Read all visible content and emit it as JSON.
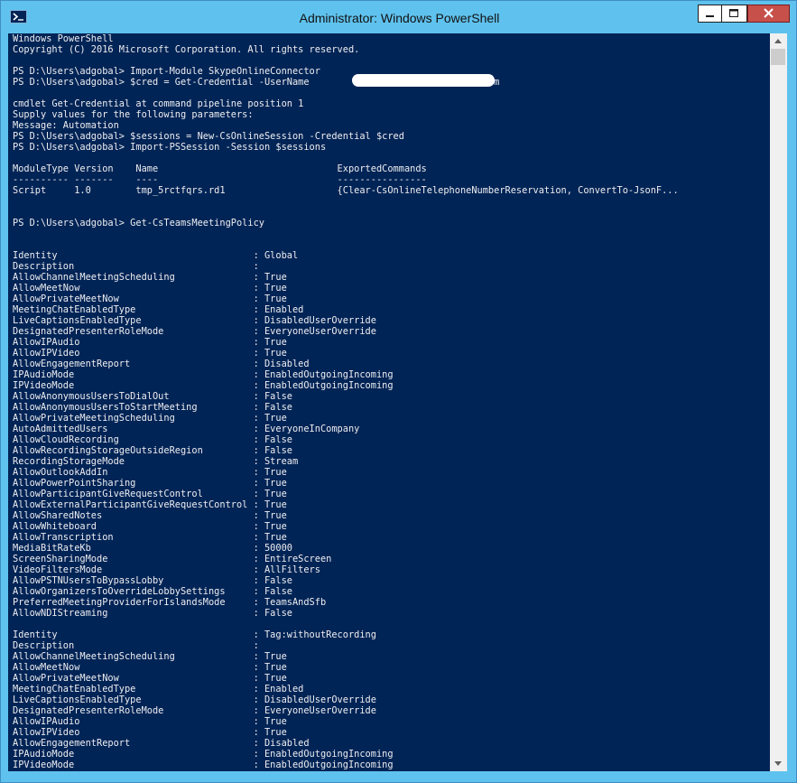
{
  "window": {
    "title": "Administrator: Windows PowerShell",
    "icon": "powershell-icon",
    "controls": [
      "minimize-icon",
      "maximize-icon",
      "close-icon"
    ]
  },
  "colors": {
    "console_bg": "#012456",
    "console_fg": "#eeedf0",
    "titlebar": "#5fc2ee",
    "close_button": "#c7504b"
  },
  "console": {
    "lines": [
      "Windows PowerShell",
      "Copyright (C) 2016 Microsoft Corporation. All rights reserved.",
      "",
      "PS D:\\Users\\adgobal> Import-Module SkypeOnlineConnector",
      "PS D:\\Users\\adgobal> $cred = Get-Credential -UserName                   ow@         com",
      "",
      "cmdlet Get-Credential at command pipeline position 1",
      "Supply values for the following parameters:",
      "Message: Automation",
      "PS D:\\Users\\adgobal> $sessions = New-CsOnlineSession -Credential $cred",
      "PS D:\\Users\\adgobal> Import-PSSession -Session $sessions",
      "",
      "ModuleType Version    Name                                ExportedCommands",
      "---------- -------    ----                                ----------------",
      "Script     1.0        tmp_5rctfqrs.rd1                    {Clear-CsOnlineTelephoneNumberReservation, ConvertTo-JsonF...",
      "",
      "",
      "PS D:\\Users\\adgobal> Get-CsTeamsMeetingPolicy",
      "",
      "",
      "Identity                                   : Global",
      "Description                                :",
      "AllowChannelMeetingScheduling              : True",
      "AllowMeetNow                               : True",
      "AllowPrivateMeetNow                        : True",
      "MeetingChatEnabledType                     : Enabled",
      "LiveCaptionsEnabledType                    : DisabledUserOverride",
      "DesignatedPresenterRoleMode                : EveryoneUserOverride",
      "AllowIPAudio                               : True",
      "AllowIPVideo                               : True",
      "AllowEngagementReport                      : Disabled",
      "IPAudioMode                                : EnabledOutgoingIncoming",
      "IPVideoMode                                : EnabledOutgoingIncoming",
      "AllowAnonymousUsersToDialOut               : False",
      "AllowAnonymousUsersToStartMeeting          : False",
      "AllowPrivateMeetingScheduling              : True",
      "AutoAdmittedUsers                          : EveryoneInCompany",
      "AllowCloudRecording                        : False",
      "AllowRecordingStorageOutsideRegion         : False",
      "RecordingStorageMode                       : Stream",
      "AllowOutlookAddIn                          : True",
      "AllowPowerPointSharing                     : True",
      "AllowParticipantGiveRequestControl         : True",
      "AllowExternalParticipantGiveRequestControl : True",
      "AllowSharedNotes                           : True",
      "AllowWhiteboard                            : True",
      "AllowTranscription                         : True",
      "MediaBitRateKb                             : 50000",
      "ScreenSharingMode                          : EntireScreen",
      "VideoFiltersMode                           : AllFilters",
      "AllowPSTNUsersToBypassLobby                : False",
      "AllowOrganizersToOverrideLobbySettings     : False",
      "PreferredMeetingProviderForIslandsMode     : TeamsAndSfb",
      "AllowNDIStreaming                          : False",
      "",
      "Identity                                   : Tag:withoutRecording",
      "Description                                :",
      "AllowChannelMeetingScheduling              : True",
      "AllowMeetNow                               : True",
      "AllowPrivateMeetNow                        : True",
      "MeetingChatEnabledType                     : Enabled",
      "LiveCaptionsEnabledType                    : DisabledUserOverride",
      "DesignatedPresenterRoleMode                : EveryoneUserOverride",
      "AllowIPAudio                               : True",
      "AllowIPVideo                               : True",
      "AllowEngagementReport                      : Disabled",
      "IPAudioMode                                : EnabledOutgoingIncoming",
      "IPVideoMode                                : EnabledOutgoingIncoming"
    ]
  }
}
